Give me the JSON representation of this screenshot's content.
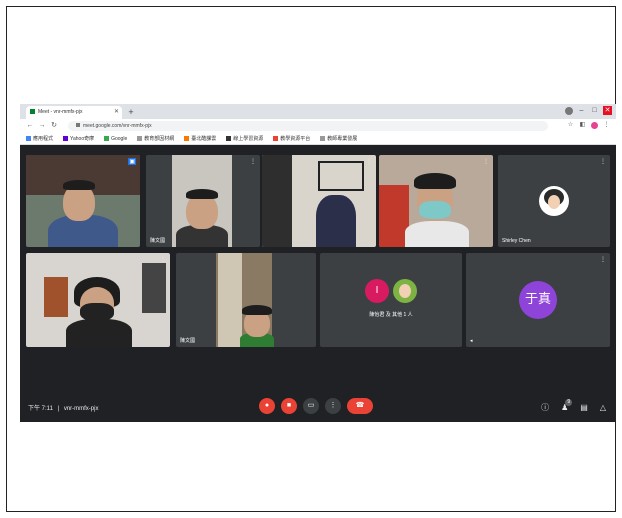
{
  "browser": {
    "tab_title": "Meet - vnr-mmfx-pjx",
    "url": "meet.google.com/vnr-mmfx-pjx",
    "bookmarks": [
      {
        "label": "應用程式",
        "color": "#4285f4"
      },
      {
        "label": "Yahoo奇摩",
        "color": "#6001d2"
      },
      {
        "label": "Google",
        "color": "#34a853"
      },
      {
        "label": "教育部因材網",
        "color": "#999999"
      },
      {
        "label": "臺北酷課雲",
        "color": "#f57c00"
      },
      {
        "label": "線上學習資源",
        "color": "#333333"
      },
      {
        "label": "教學資源平台",
        "color": "#ea4335"
      },
      {
        "label": "教師專業發展",
        "color": "#999999"
      }
    ]
  },
  "meeting": {
    "participants": [
      {
        "name": "",
        "type": "video"
      },
      {
        "name": "陳文國",
        "type": "video"
      },
      {
        "name": "",
        "type": "video"
      },
      {
        "name": "",
        "type": "video"
      },
      {
        "name": "Shirley Chen",
        "type": "avatar-photo"
      },
      {
        "name": "",
        "type": "video"
      },
      {
        "name": "陳文國",
        "type": "video"
      },
      {
        "name": "陳怡君 及 其他 1 人",
        "type": "dual-avatar",
        "initial": "I"
      },
      {
        "name": "",
        "type": "letter-avatar",
        "letter": "于真"
      }
    ],
    "time": "下午 7:11",
    "meeting_code": "vnr-mmfx-pjx",
    "controls": {
      "mic_icon": "mic-off-icon",
      "cam_icon": "videocam-off-icon",
      "cc_icon": "captions-icon",
      "present_icon": "present-icon",
      "more_icon": "more-vert-icon",
      "end_icon": "call-end-icon"
    },
    "people_count": "9"
  },
  "colors": {
    "background": "#202124",
    "tile": "#3c4043",
    "end_call": "#ea4335",
    "letter_avatar": "#8e44d8"
  }
}
